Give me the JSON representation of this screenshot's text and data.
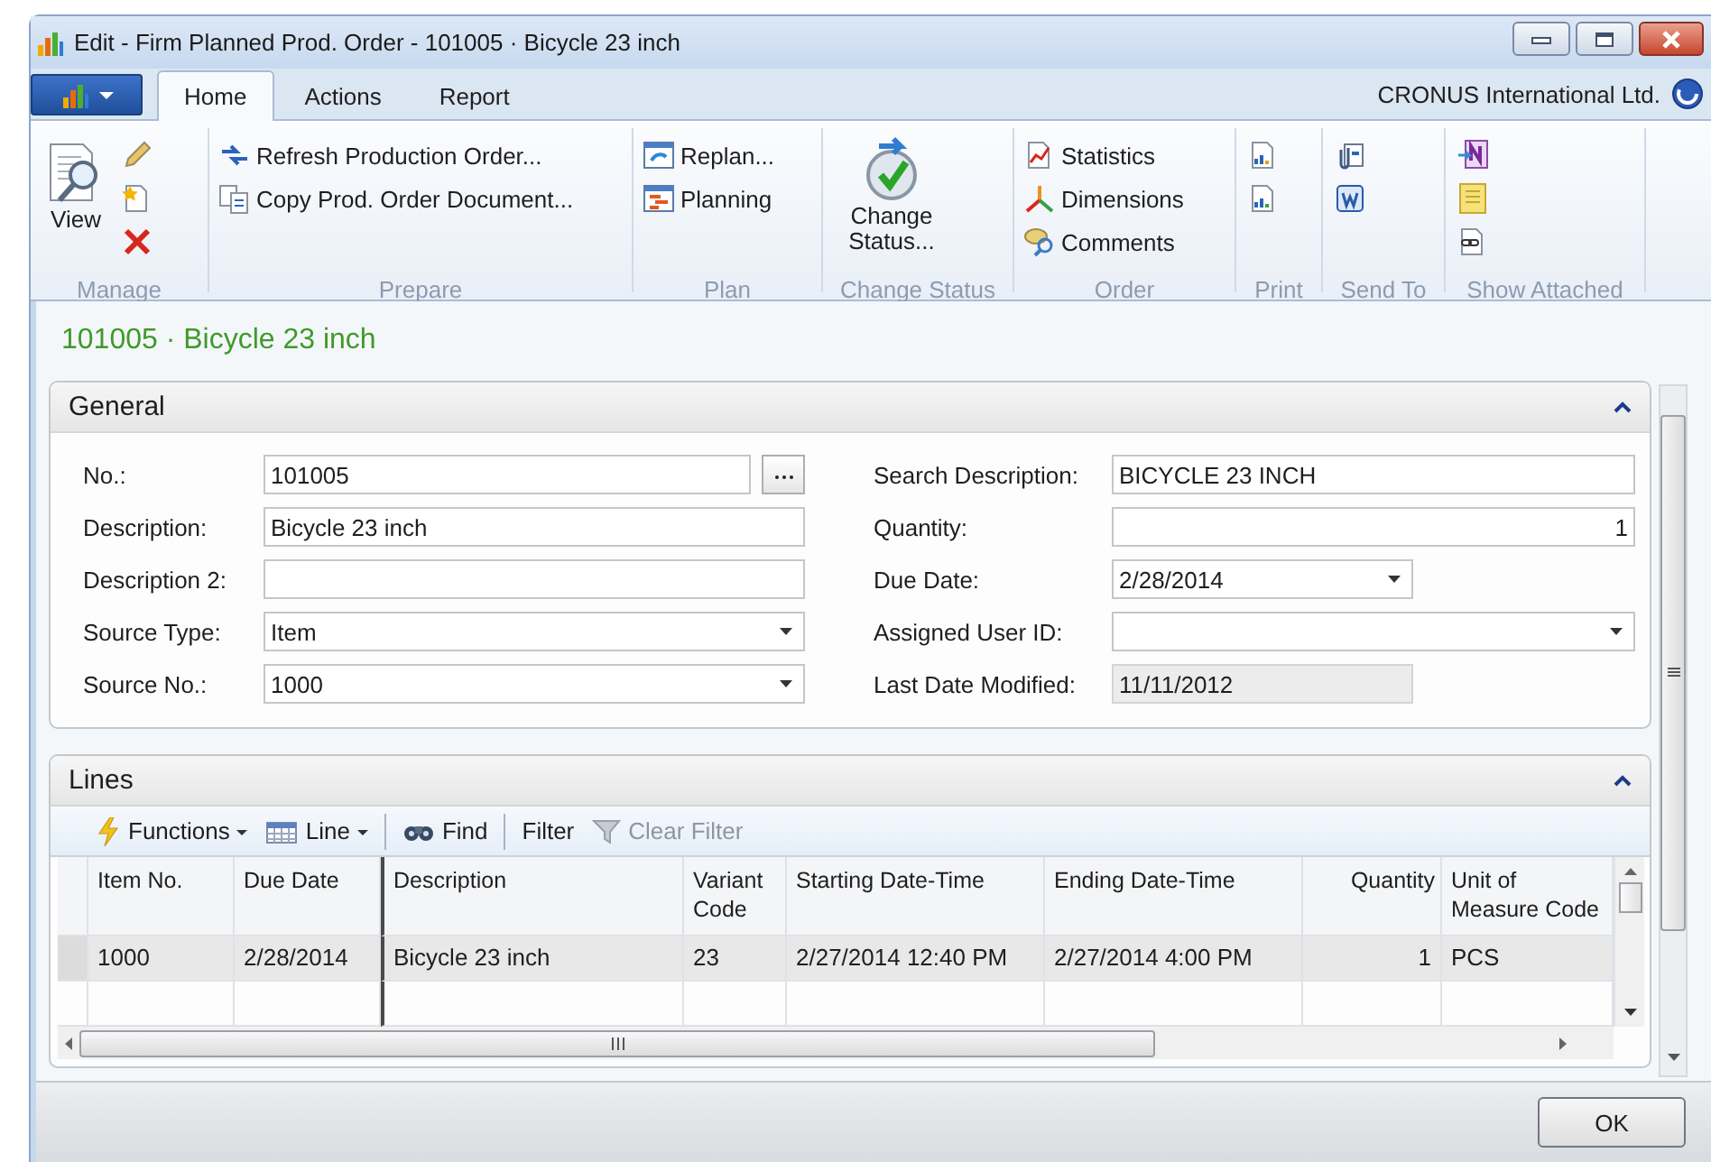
{
  "window": {
    "title": "Edit - Firm Planned Prod. Order - 101005 · Bicycle 23 inch"
  },
  "ribbon": {
    "tabs": [
      {
        "label": "Home",
        "selected": true
      },
      {
        "label": "Actions",
        "selected": false
      },
      {
        "label": "Report",
        "selected": false
      }
    ],
    "company": "CRONUS International Ltd.",
    "groups": [
      {
        "label": "Manage",
        "items": [
          {
            "kind": "large",
            "label": "View"
          },
          {
            "kind": "icon"
          },
          {
            "kind": "icon"
          },
          {
            "kind": "icon"
          }
        ]
      },
      {
        "label": "Prepare",
        "items": [
          {
            "kind": "small",
            "label": "Refresh Production Order..."
          },
          {
            "kind": "small",
            "label": "Copy Prod. Order Document..."
          }
        ]
      },
      {
        "label": "Plan",
        "items": [
          {
            "kind": "small",
            "label": "Replan..."
          },
          {
            "kind": "small",
            "label": "Planning"
          }
        ]
      },
      {
        "label": "Change Status",
        "items": [
          {
            "kind": "large",
            "label": "Change Status..."
          }
        ]
      },
      {
        "label": "Order",
        "items": [
          {
            "kind": "small",
            "label": "Statistics"
          },
          {
            "kind": "small",
            "label": "Dimensions"
          },
          {
            "kind": "small",
            "label": "Comments"
          }
        ]
      },
      {
        "label": "Print",
        "items": [
          {
            "kind": "icon"
          },
          {
            "kind": "icon"
          }
        ]
      },
      {
        "label": "Send To",
        "items": [
          {
            "kind": "icon"
          },
          {
            "kind": "icon"
          }
        ]
      },
      {
        "label": "Show Attached",
        "items": [
          {
            "kind": "icon"
          },
          {
            "kind": "icon"
          },
          {
            "kind": "icon"
          }
        ]
      }
    ]
  },
  "page": {
    "heading": "101005 · Bicycle 23 inch"
  },
  "general": {
    "title": "General",
    "expanded": true,
    "left": [
      {
        "label": "No.:",
        "kind": "lookup",
        "value": "101005"
      },
      {
        "label": "Description:",
        "kind": "text",
        "value": "Bicycle 23 inch"
      },
      {
        "label": "Description 2:",
        "kind": "text"
      },
      {
        "label": "Source Type:",
        "kind": "dropdown",
        "value": "Item"
      },
      {
        "label": "Source No.:",
        "kind": "dropdown",
        "value": "1000"
      }
    ],
    "right": [
      {
        "label": "Search Description:",
        "kind": "text",
        "value": "BICYCLE 23 INCH"
      },
      {
        "label": "Quantity:",
        "kind": "number",
        "value": "1"
      },
      {
        "label": "Due Date:",
        "kind": "date",
        "value": "2/28/2014"
      },
      {
        "label": "Assigned User ID:",
        "kind": "dropdown"
      },
      {
        "label": "Last Date Modified:",
        "kind": "readonly",
        "value": "11/11/2012"
      }
    ]
  },
  "lines": {
    "title": "Lines",
    "expanded": true,
    "toolbar": [
      {
        "label": "Functions",
        "kind": "menu",
        "disabled": false
      },
      {
        "label": "Line",
        "kind": "menu",
        "disabled": false
      },
      {
        "label": "Find",
        "kind": "action",
        "disabled": false
      },
      {
        "label": "Filter",
        "kind": "plain",
        "disabled": false
      },
      {
        "label": "Clear Filter",
        "kind": "action",
        "disabled": true
      }
    ],
    "columns": [
      {
        "label": "Item No.",
        "kind": "text"
      },
      {
        "label": "Due Date",
        "kind": "text"
      },
      {
        "label": "Description",
        "kind": "text"
      },
      {
        "label": "Variant Code",
        "kind": "text"
      },
      {
        "label": "Starting Date-Time",
        "kind": "text"
      },
      {
        "label": "Ending Date-Time",
        "kind": "text"
      },
      {
        "label": "Quantity",
        "kind": "number"
      },
      {
        "label": "Unit of Measure Code",
        "kind": "text"
      }
    ],
    "rows": [
      {
        "selected": true,
        "cells": [
          "1000",
          "2/28/2014",
          "Bicycle 23 inch",
          "23",
          "2/27/2014 12:40 PM",
          "2/27/2014 4:00 PM",
          "1",
          "PCS"
        ]
      }
    ]
  },
  "footer": {
    "buttons": [
      "OK"
    ]
  }
}
